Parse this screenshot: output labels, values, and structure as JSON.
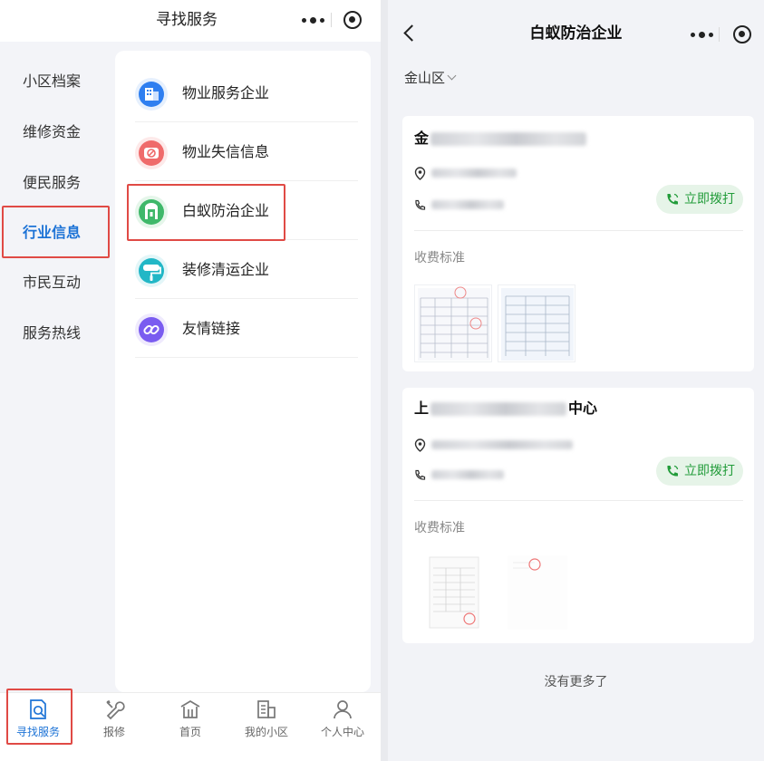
{
  "left": {
    "title": "寻找服务",
    "sidebar": [
      {
        "label": "小区档案",
        "active": false
      },
      {
        "label": "维修资金",
        "active": false
      },
      {
        "label": "便民服务",
        "active": false
      },
      {
        "label": "行业信息",
        "active": true
      },
      {
        "label": "市民互动",
        "active": false
      },
      {
        "label": "服务热线",
        "active": false
      }
    ],
    "menu": [
      {
        "label": "物业服务企业",
        "icon": "building-icon",
        "color": "#2f7ff0"
      },
      {
        "label": "物业失信信息",
        "icon": "no-entry-icon",
        "color": "#ef6b6b"
      },
      {
        "label": "白蚁防治企业",
        "icon": "door-icon",
        "color": "#3fb86a"
      },
      {
        "label": "装修清运企业",
        "icon": "paint-roller-icon",
        "color": "#22b7c6"
      },
      {
        "label": "友情链接",
        "icon": "link-icon",
        "color": "#7a5cf0"
      }
    ],
    "tabs": [
      {
        "label": "寻找服务",
        "icon": "search-doc-icon",
        "active": true
      },
      {
        "label": "报修",
        "icon": "wrench-icon",
        "active": false
      },
      {
        "label": "首页",
        "icon": "home-icon",
        "active": false
      },
      {
        "label": "我的小区",
        "icon": "community-icon",
        "active": false
      },
      {
        "label": "个人中心",
        "icon": "person-icon",
        "active": false
      }
    ],
    "accent_color": "#1d73d6",
    "highlight_color": "#e04a45"
  },
  "right": {
    "title": "白蚁防治企业",
    "district": "金山区",
    "companies": [
      {
        "name_prefix": "金",
        "name_suffix": "",
        "call_label": "立即拨打",
        "fee_label": "收费标准"
      },
      {
        "name_prefix": "上",
        "name_suffix": "中心",
        "call_label": "立即拨打",
        "fee_label": "收费标准"
      }
    ],
    "end_text": "没有更多了",
    "call_color": "#229c3a"
  }
}
